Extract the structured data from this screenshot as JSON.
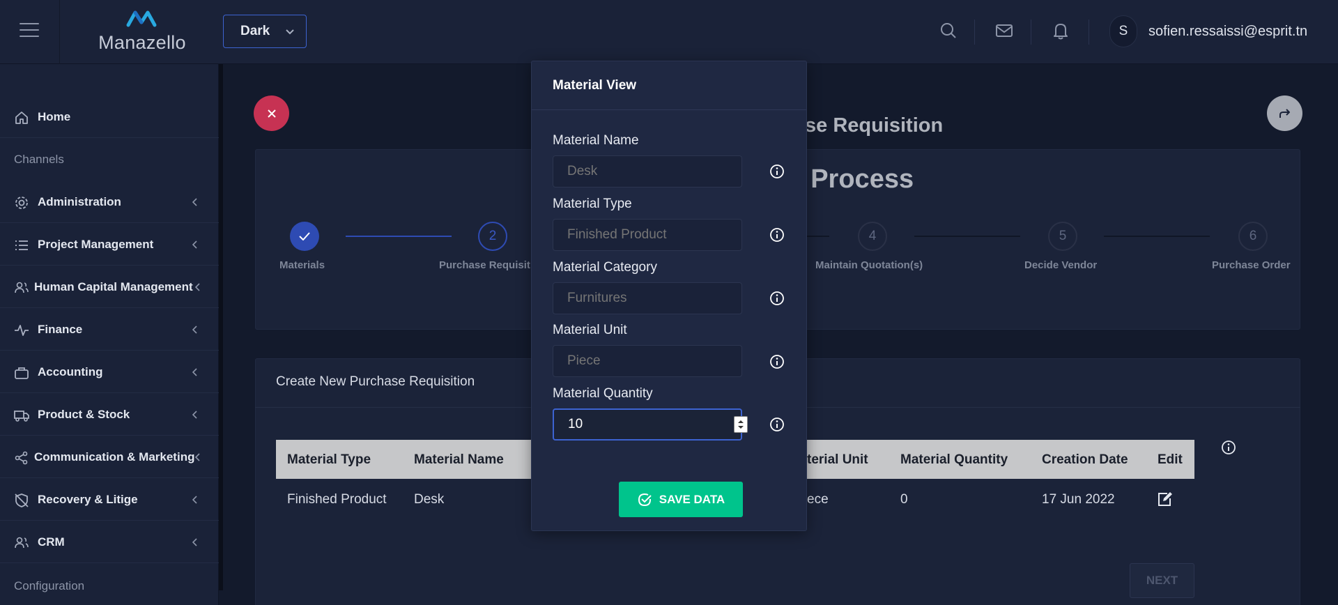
{
  "header": {
    "brand": "Manazello",
    "theme_select": "Dark",
    "user_initial": "S",
    "user_email": "sofien.ressaissi@esprit.tn"
  },
  "sidebar": {
    "items": [
      {
        "label": "Home",
        "icon": "home-icon"
      },
      {
        "label": "Administration",
        "icon": "gear-icon"
      },
      {
        "label": "Project Management",
        "icon": "list-icon"
      },
      {
        "label": "Human Capital Management",
        "icon": "users-icon"
      },
      {
        "label": "Finance",
        "icon": "activity-icon"
      },
      {
        "label": "Accounting",
        "icon": "briefcase-icon"
      },
      {
        "label": "Product & Stock",
        "icon": "truck-icon"
      },
      {
        "label": "Communication & Marketing",
        "icon": "share-icon"
      },
      {
        "label": "Recovery & Litige",
        "icon": "shield-off-icon"
      },
      {
        "label": "CRM",
        "icon": "users-icon"
      }
    ],
    "headings": [
      "Channels",
      "Configuration"
    ]
  },
  "main": {
    "heading_partial": "se Requisition",
    "process_title_partial": ": Process",
    "steps": [
      {
        "number": "",
        "label": "Materials",
        "state": "done"
      },
      {
        "number": "2",
        "label": "Purchase Requisit",
        "state": "current"
      },
      {
        "number": "4",
        "label": "Maintain Quotation(s)",
        "state": "todo"
      },
      {
        "number": "5",
        "label": "Decide Vendor",
        "state": "todo"
      },
      {
        "number": "6",
        "label": "Purchase Order",
        "state": "todo"
      }
    ],
    "table_card_title": "Create New Purchase Requisition",
    "table": {
      "headers": [
        "Material Type",
        "Material Name",
        "terial Unit",
        "Material Quantity",
        "Creation Date",
        "Edit"
      ],
      "row": [
        "Finished Product",
        "Desk",
        "ece",
        "0",
        "17 Jun 2022"
      ]
    },
    "next_label": "NEXT"
  },
  "modal": {
    "title": "Material View",
    "fields": [
      {
        "label": "Material Name",
        "placeholder": "Desk"
      },
      {
        "label": "Material Type",
        "placeholder": "Finished Product"
      },
      {
        "label": "Material Category",
        "placeholder": "Furnitures"
      },
      {
        "label": "Material Unit",
        "placeholder": "Piece"
      },
      {
        "label": "Material Quantity",
        "value": "10"
      }
    ],
    "save_label": "SAVE DATA"
  },
  "colors": {
    "accent": "#3d63d1",
    "save": "#00c48c",
    "close": "#c73253"
  }
}
